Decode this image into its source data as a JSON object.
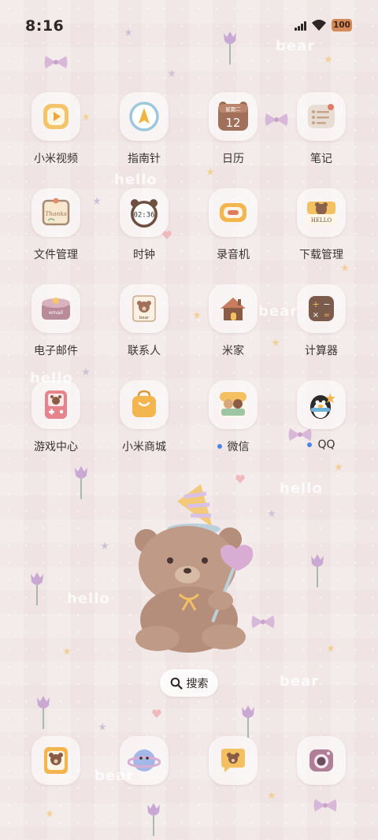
{
  "status_bar": {
    "time": "8:16",
    "battery": "100"
  },
  "wallpaper": {
    "text_1": "bear",
    "text_2": "hello",
    "text_3": "bear",
    "text_4": "hello",
    "text_5": "hello",
    "text_6": "hello",
    "text_7": "bear",
    "text_8": "bear"
  },
  "apps": [
    {
      "label": "小米视频",
      "icon": "video-player-icon"
    },
    {
      "label": "指南针",
      "icon": "compass-icon"
    },
    {
      "label": "日历",
      "icon": "calendar-icon",
      "calendar_day": "12",
      "calendar_weekday": "星期二"
    },
    {
      "label": "笔记",
      "icon": "notes-icon"
    },
    {
      "label": "文件管理",
      "icon": "file-manager-icon",
      "icon_text": "Thanks"
    },
    {
      "label": "时钟",
      "icon": "clock-icon",
      "clock_time": "02:36"
    },
    {
      "label": "录音机",
      "icon": "recorder-icon"
    },
    {
      "label": "下载管理",
      "icon": "download-manager-icon",
      "icon_text": "HELLO"
    },
    {
      "label": "电子邮件",
      "icon": "email-icon",
      "icon_text": "email"
    },
    {
      "label": "联系人",
      "icon": "contacts-icon",
      "icon_text": "bear"
    },
    {
      "label": "米家",
      "icon": "mi-home-icon"
    },
    {
      "label": "计算器",
      "icon": "calculator-icon"
    },
    {
      "label": "游戏中心",
      "icon": "game-center-icon"
    },
    {
      "label": "小米商城",
      "icon": "mi-store-icon"
    },
    {
      "label": "微信",
      "icon": "wechat-icon",
      "has_dot": true
    },
    {
      "label": "QQ",
      "icon": "qq-icon",
      "has_dot": true
    }
  ],
  "search": {
    "label": "搜索"
  },
  "dock": [
    {
      "icon": "dock-bear-photo-icon"
    },
    {
      "icon": "browser-planet-icon"
    },
    {
      "icon": "messages-bear-icon"
    },
    {
      "icon": "camera-icon"
    }
  ],
  "colors": {
    "notification_dot": "#4a86e8",
    "battery": "#d68a57",
    "background": "#efe3e3"
  }
}
